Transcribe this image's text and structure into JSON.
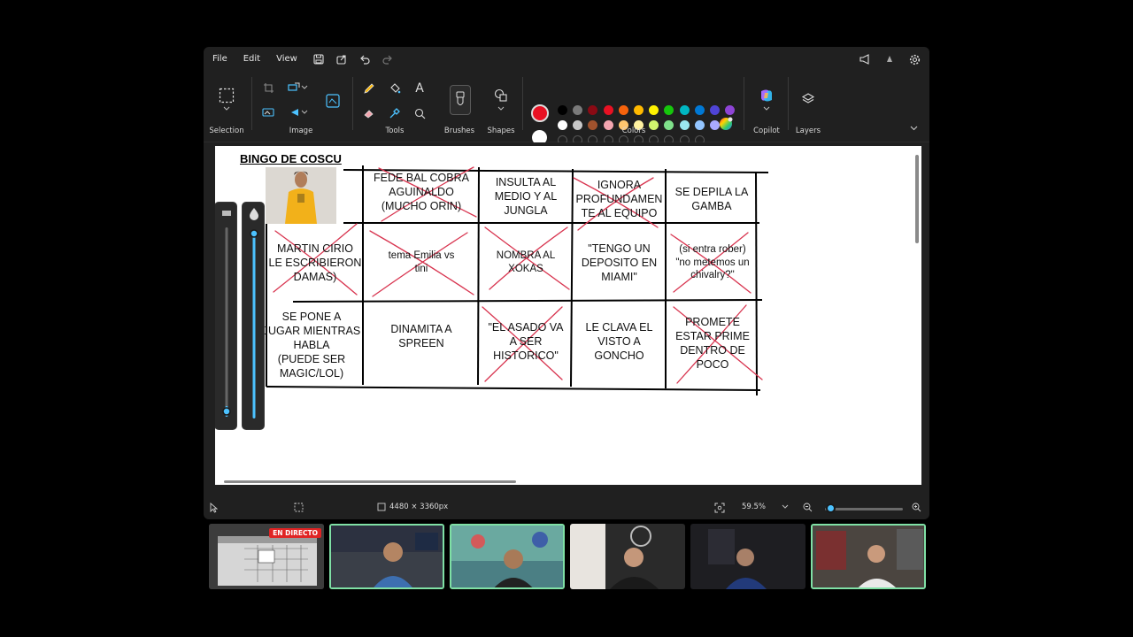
{
  "menu": {
    "file": "File",
    "edit": "Edit",
    "view": "View"
  },
  "ribbon": {
    "selection": "Selection",
    "image": "Image",
    "tools": "Tools",
    "brushes": "Brushes",
    "shapes": "Shapes",
    "colors": "Colors",
    "copilot": "Copilot",
    "layers": "Layers",
    "text_tool": "A"
  },
  "palette": {
    "primary": "#e81123",
    "secondary": "#ffffff",
    "row1": [
      "#000000",
      "#7a7a7a",
      "#8b0a14",
      "#e81123",
      "#f7630c",
      "#ffb900",
      "#fff100",
      "#16c60c",
      "#00b7c3",
      "#0078d4",
      "#4f44d6",
      "#8e44d6"
    ],
    "row2": [
      "#ffffff",
      "#c8c8c8",
      "#a0522d",
      "#f4a6b0",
      "#ffc66e",
      "#fff2a0",
      "#d2f56e",
      "#7fe08a",
      "#9ae6f0",
      "#93c5ff",
      "#a9a9ff"
    ]
  },
  "document": {
    "title": "BINGO DE COSCU",
    "cells": [
      "FEDE BAL COBRA\nAGUINALDO\n(MUCHO ORIN)",
      "INSULTA AL\nMEDIO Y AL\nJUNGLA",
      "IGNORA\nPROFUNDAMEN\nTE AL EQUIPO",
      "SE DEPILA LA\nGAMBA",
      "MARTIN CIRIO\nLE ESCRIBIERON\nDAMAS)",
      "tema Emilia vs\ntini",
      "NOMBRA AL\nXOKAS",
      "\"TENGO UN\nDEPOSITO EN\nMIAMI\"",
      "(si entra rober)\n\"no metemos un\nchivalry?\"",
      "SE PONE A\nJUGAR MIENTRAS\nHABLA\n(PUEDE SER\nMAGIC/LOL)",
      "DINAMITA A\nSPREEN",
      "\"EL ASADO VA\nA SER\nHISTORICO\"",
      "LE CLAVA EL\nVISTO A\nGONCHO",
      "PROMETE\nESTAR PRIME\nDENTRO DE\nPOCO"
    ]
  },
  "status": {
    "dimensions": "4480 × 3360px",
    "zoom": "59.5%"
  },
  "stream": {
    "live_badge": "EN DIRECTO"
  }
}
